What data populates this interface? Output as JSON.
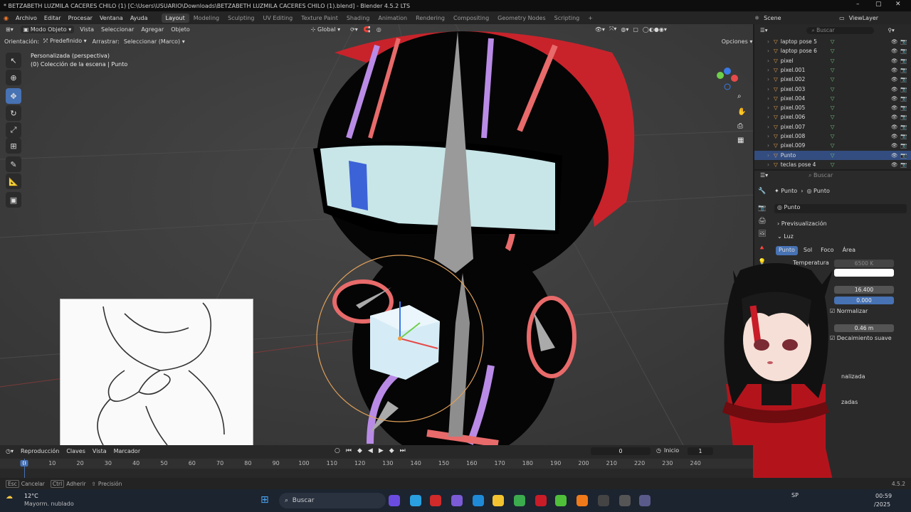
{
  "window_title": "* BETZABETH LUZMILA CACERES CHILO (1) [C:\\Users\\USUARIO\\Downloads\\BETZABETH LUZMILA CACERES CHILO (1).blend] - Blender 4.5.2 LTS",
  "menus": [
    "Archivo",
    "Editar",
    "Procesar",
    "Ventana",
    "Ayuda"
  ],
  "workspaces": [
    "Layout",
    "Modeling",
    "Sculpting",
    "UV Editing",
    "Texture Paint",
    "Shading",
    "Animation",
    "Rendering",
    "Compositing",
    "Geometry Nodes",
    "Scripting"
  ],
  "scene": {
    "scene_name": "Scene",
    "view_layer": "ViewLayer"
  },
  "header": {
    "mode": "Modo Objeto",
    "view": "Vista",
    "select": "Seleccionar",
    "add": "Agregar",
    "object": "Objeto",
    "transform": "Global"
  },
  "header2": {
    "orientation_label": "Orientación:",
    "orientation_value": "Predefinido",
    "drag_label": "Arrastrar:",
    "drag_value": "Seleccionar (Marco)",
    "options": "Opciones"
  },
  "viewport": {
    "view_name": "Personalizada (perspectiva)",
    "collection": "(0) Colección de la escena | Punto"
  },
  "outliner": {
    "search": "Buscar",
    "items": [
      {
        "name": "laptop pose 5",
        "selected": false
      },
      {
        "name": "laptop pose 6",
        "selected": false
      },
      {
        "name": "pixel",
        "selected": false
      },
      {
        "name": "pixel.001",
        "selected": false
      },
      {
        "name": "pixel.002",
        "selected": false
      },
      {
        "name": "pixel.003",
        "selected": false
      },
      {
        "name": "pixel.004",
        "selected": false
      },
      {
        "name": "pixel.005",
        "selected": false
      },
      {
        "name": "pixel.006",
        "selected": false
      },
      {
        "name": "pixel.007",
        "selected": false
      },
      {
        "name": "pixel.008",
        "selected": false
      },
      {
        "name": "pixel.009",
        "selected": false
      },
      {
        "name": "Punto",
        "selected": true
      },
      {
        "name": "teclas pose 4",
        "selected": false
      }
    ]
  },
  "properties": {
    "search": "Buscar",
    "breadcrumb_a": "Punto",
    "breadcrumb_b": "Punto",
    "data_name": "Punto",
    "preview": "Previsualización",
    "light": "Luz",
    "light_types": [
      "Punto",
      "Sol",
      "Foco",
      "Área"
    ],
    "temperature_label": "Temperatura",
    "temperature_value": "6500 K",
    "power": "16.400",
    "diffuse": "0.000",
    "normalize": "Normalizar",
    "radius": "0.46 m",
    "soft_falloff": "Decaimiento suave",
    "partial_1": "nalizada",
    "partial_2": "zadas"
  },
  "timeline": {
    "menus": [
      "Reproducción",
      "Claves",
      "Vista",
      "Marcador"
    ],
    "current_frame": "0",
    "start_label": "Inicio",
    "start_value": "1",
    "ticks": [
      "0",
      "10",
      "20",
      "30",
      "40",
      "50",
      "60",
      "70",
      "80",
      "90",
      "100",
      "110",
      "120",
      "130",
      "140",
      "150",
      "160",
      "170",
      "180",
      "190",
      "200",
      "210",
      "220",
      "230",
      "240"
    ]
  },
  "status": {
    "cancel_key": "Esc",
    "cancel": "Cancelar",
    "snap_key": "Ctrl",
    "snap": "Adherir",
    "precision_key": "⇧",
    "precision": "Precisión",
    "version": "4.5.2"
  },
  "taskbar": {
    "temperature": "12°C",
    "weather": "Mayorm. nublado",
    "search": "Buscar",
    "time": "00:59",
    "date": "/2025",
    "lang": "SP"
  }
}
